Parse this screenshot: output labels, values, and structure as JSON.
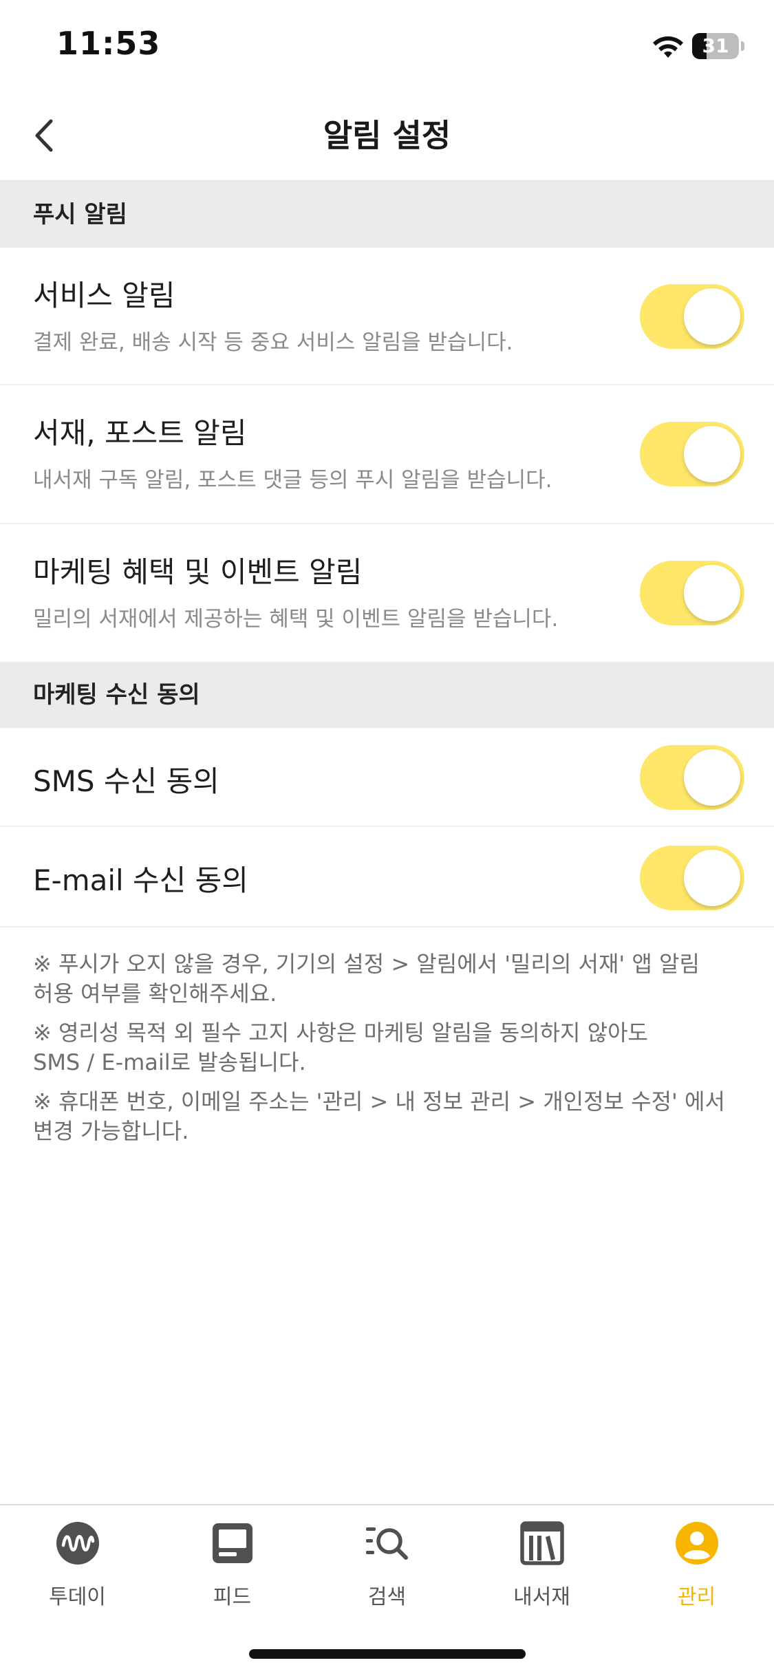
{
  "status_bar": {
    "time": "11:53",
    "battery_level": "31",
    "battery_fraction": 0.31
  },
  "header": {
    "title": "알림 설정",
    "back_icon": "chevron-left-icon"
  },
  "sections": {
    "push": {
      "title": "푸시 알림",
      "items": [
        {
          "title": "서비스 알림",
          "description": "결제 완료, 배송 시작 등 중요 서비스 알림을 받습니다.",
          "enabled": true
        },
        {
          "title": "서재, 포스트 알림",
          "description": "내서재 구독 알림, 포스트 댓글 등의 푸시 알림을 받습니다.",
          "enabled": true
        },
        {
          "title": "마케팅 혜택 및 이벤트 알림",
          "description": "밀리의 서재에서 제공하는 혜택 및 이벤트 알림을 받습니다.",
          "enabled": true
        }
      ]
    },
    "marketing": {
      "title": "마케팅 수신 동의",
      "items": [
        {
          "title": "SMS 수신 동의",
          "enabled": true
        },
        {
          "title": "E-mail 수신 동의",
          "enabled": true
        }
      ]
    }
  },
  "notices": [
    "※ 푸시가 오지 않을 경우, 기기의 설정 > 알림에서 '밀리의 서재' 앱 알림\n허용 여부를 확인해주세요.",
    "※ 영리성 목적 외 필수 고지 사항은 마케팅 알림을 동의하지 않아도\nSMS / E-mail로 발송됩니다.",
    "※ 휴대폰 번호, 이메일 주소는 '관리 > 내 정보 관리 > 개인정보 수정' 에서\n변경 가능합니다."
  ],
  "tab_bar": {
    "items": [
      {
        "label": "투데이",
        "icon": "today-wave-icon",
        "active": false
      },
      {
        "label": "피드",
        "icon": "feed-icon",
        "active": false
      },
      {
        "label": "검색",
        "icon": "search-icon",
        "active": false
      },
      {
        "label": "내서재",
        "icon": "library-icon",
        "active": false
      },
      {
        "label": "관리",
        "icon": "profile-icon",
        "active": true
      }
    ]
  },
  "colors": {
    "accent": "#fde668",
    "active_tab": "#f2b705",
    "section_bg": "#ebebeb"
  }
}
